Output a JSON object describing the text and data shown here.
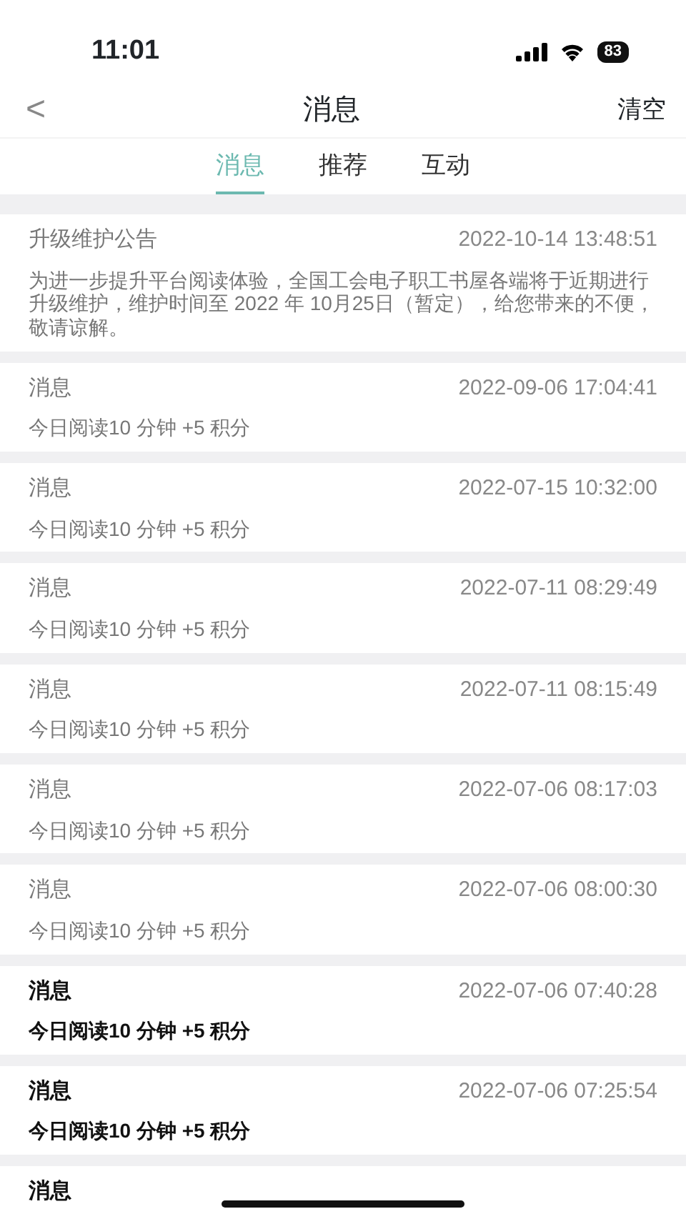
{
  "status_bar": {
    "time": "11:01",
    "battery": "83"
  },
  "header": {
    "back": "<",
    "title": "消息",
    "action": "清空"
  },
  "tabs": [
    {
      "label": "消息",
      "selected": true
    },
    {
      "label": "推荐",
      "selected": false
    },
    {
      "label": "互动",
      "selected": false
    }
  ],
  "messages": [
    {
      "title": "升级维护公告",
      "time": "2022-10-14 13:48:51",
      "body": "为进一步提升平台阅读体验，全国工会电子职工书屋各端将于近期进行升级维护，维护时间至 2022 年 10月25日（暂定），给您带来的不便，敬请谅解。",
      "read": true
    },
    {
      "title": "消息",
      "time": "2022-09-06 17:04:41",
      "body": "今日阅读10 分钟 +5 积分",
      "read": true
    },
    {
      "title": "消息",
      "time": "2022-07-15 10:32:00",
      "body": "今日阅读10 分钟 +5 积分",
      "read": true
    },
    {
      "title": "消息",
      "time": "2022-07-11 08:29:49",
      "body": "今日阅读10 分钟 +5 积分",
      "read": true
    },
    {
      "title": "消息",
      "time": "2022-07-11 08:15:49",
      "body": "今日阅读10 分钟 +5 积分",
      "read": true
    },
    {
      "title": "消息",
      "time": "2022-07-06 08:17:03",
      "body": "今日阅读10 分钟 +5 积分",
      "read": true
    },
    {
      "title": "消息",
      "time": "2022-07-06 08:00:30",
      "body": "今日阅读10 分钟 +5 积分",
      "read": true
    },
    {
      "title": "消息",
      "time": "2022-07-06 07:40:28",
      "body": "今日阅读10 分钟 +5 积分",
      "read": false
    },
    {
      "title": "消息",
      "time": "2022-07-06 07:25:54",
      "body": "今日阅读10 分钟 +5 积分",
      "read": false
    },
    {
      "title": "消息",
      "read": false
    }
  ]
}
